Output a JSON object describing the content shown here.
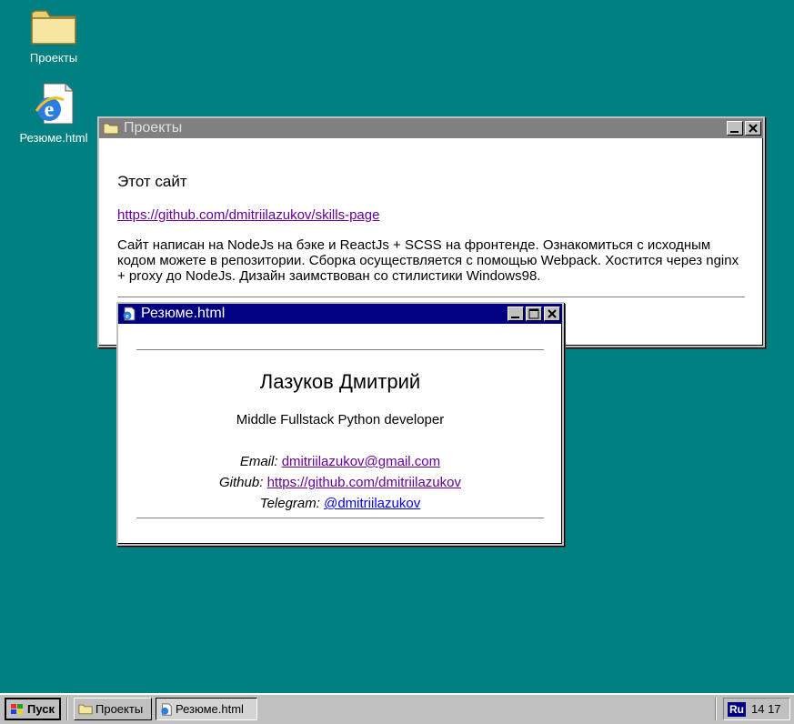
{
  "desktop": {
    "icons": [
      {
        "label": "Проекты"
      },
      {
        "label": "Резюме.html"
      }
    ]
  },
  "projects_window": {
    "title": "Проекты",
    "heading": "Этот сайт",
    "link": "https://github.com/dmitriilazukov/skills-page",
    "description": "Сайт написан на NodeJs на бэке и ReactJs + SCSS на фронтенде. Ознакомиться с исходным кодом можете в репозитории. Сборка осуществляется с помощью Webpack. Хостится через nginx + proxy до NodeJs. Дизайн заимствован со стилистики Windows98."
  },
  "resume_window": {
    "title": "Резюме.html",
    "name": "Лазуков Дмитрий",
    "role": "Middle Fullstack Python developer",
    "email_label": "Email:",
    "email": "dmitriilazukov@gmail.com",
    "github_label": "Github:",
    "github": "https://github.com/dmitriilazukov",
    "telegram_label": "Telegram:",
    "telegram": "@dmitriilazukov"
  },
  "taskbar": {
    "start_label": "Пуск",
    "tasks": [
      {
        "label": "Проекты"
      },
      {
        "label": "Резюме.html"
      }
    ],
    "lang": "Ru",
    "clock": "14 17"
  },
  "colors": {
    "desktop": "#008080",
    "active_title": "#000080",
    "inactive_title": "#808080"
  }
}
